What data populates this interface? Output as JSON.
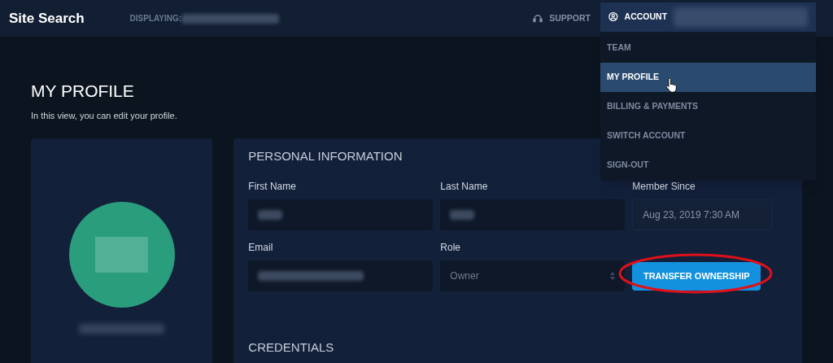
{
  "header": {
    "title": "Site Search",
    "displaying_label": "DISPLAYING:",
    "support": "SUPPORT",
    "account": "ACCOUNT"
  },
  "account_menu": [
    {
      "label": "TEAM",
      "selected": false
    },
    {
      "label": "MY PROFILE",
      "selected": true
    },
    {
      "label": "BILLING & PAYMENTS",
      "selected": false
    },
    {
      "label": "SWITCH ACCOUNT",
      "selected": false
    },
    {
      "label": "SIGN-OUT",
      "selected": false
    }
  ],
  "page": {
    "title": "MY PROFILE",
    "subtitle": "In this view, you can edit your profile."
  },
  "personal_information": {
    "heading": "PERSONAL INFORMATION",
    "fields": [
      {
        "label": "First Name",
        "kind": "redacted"
      },
      {
        "label": "Last Name",
        "kind": "redacted"
      },
      {
        "label": "Member Since",
        "kind": "readonly",
        "value": "Aug 23, 2019 7:30 AM"
      },
      {
        "label": "Email",
        "kind": "redacted"
      },
      {
        "label": "Role",
        "kind": "select",
        "value": "Owner"
      },
      {
        "kind": "button",
        "value": "TRANSFER OWNERSHIP",
        "highlighted": true
      }
    ]
  },
  "credentials": {
    "heading": "CREDENTIALS"
  }
}
